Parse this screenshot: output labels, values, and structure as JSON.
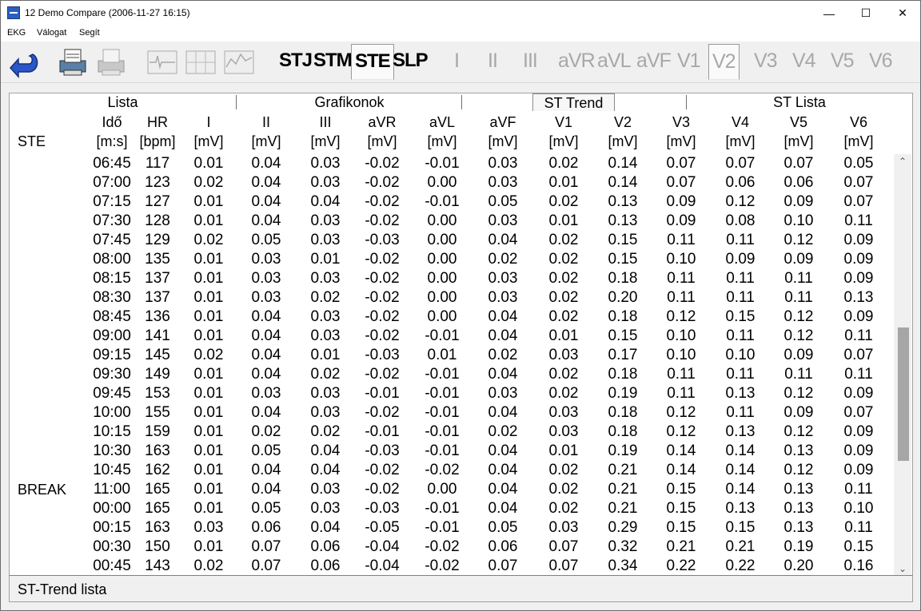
{
  "window": {
    "title": "12 Demo Compare (2006-11-27 16:15)"
  },
  "menu": [
    "EKG",
    "Válogat",
    "Segít"
  ],
  "toolbar": {
    "modes": [
      "STJ",
      "STM",
      "STE",
      "SLP"
    ],
    "active_mode": "STE",
    "leads": [
      "I",
      "II",
      "III",
      "aVR",
      "aVL",
      "aVF",
      "V1",
      "V2",
      "V3",
      "V4",
      "V5",
      "V6"
    ],
    "active_lead": "V2"
  },
  "tabs": [
    "Lista",
    "Grafikonok",
    "ST Trend",
    "ST Lista"
  ],
  "active_tab": "ST Trend",
  "table": {
    "mode_label": "STE",
    "columns": [
      {
        "name": "Idő",
        "unit": "[m:s]"
      },
      {
        "name": "HR",
        "unit": "[bpm]"
      },
      {
        "name": "I",
        "unit": "[mV]"
      },
      {
        "name": "II",
        "unit": "[mV]"
      },
      {
        "name": "III",
        "unit": "[mV]"
      },
      {
        "name": "aVR",
        "unit": "[mV]"
      },
      {
        "name": "aVL",
        "unit": "[mV]"
      },
      {
        "name": "aVF",
        "unit": "[mV]"
      },
      {
        "name": "V1",
        "unit": "[mV]"
      },
      {
        "name": "V2",
        "unit": "[mV]"
      },
      {
        "name": "V3",
        "unit": "[mV]"
      },
      {
        "name": "V4",
        "unit": "[mV]"
      },
      {
        "name": "V5",
        "unit": "[mV]"
      },
      {
        "name": "V6",
        "unit": "[mV]"
      }
    ],
    "rows": [
      {
        "label": "",
        "values": [
          "06:45",
          "117",
          "0.01",
          "0.04",
          "0.03",
          "-0.02",
          "-0.01",
          "0.03",
          "0.02",
          "0.14",
          "0.07",
          "0.07",
          "0.07",
          "0.05"
        ]
      },
      {
        "label": "",
        "values": [
          "07:00",
          "123",
          "0.02",
          "0.04",
          "0.03",
          "-0.02",
          "0.00",
          "0.03",
          "0.01",
          "0.14",
          "0.07",
          "0.06",
          "0.06",
          "0.07"
        ]
      },
      {
        "label": "",
        "values": [
          "07:15",
          "127",
          "0.01",
          "0.04",
          "0.04",
          "-0.02",
          "-0.01",
          "0.05",
          "0.02",
          "0.13",
          "0.09",
          "0.12",
          "0.09",
          "0.07"
        ]
      },
      {
        "label": "",
        "values": [
          "07:30",
          "128",
          "0.01",
          "0.04",
          "0.03",
          "-0.02",
          "0.00",
          "0.03",
          "0.01",
          "0.13",
          "0.09",
          "0.08",
          "0.10",
          "0.11"
        ]
      },
      {
        "label": "",
        "values": [
          "07:45",
          "129",
          "0.02",
          "0.05",
          "0.03",
          "-0.03",
          "0.00",
          "0.04",
          "0.02",
          "0.15",
          "0.11",
          "0.11",
          "0.12",
          "0.09"
        ]
      },
      {
        "label": "",
        "values": [
          "08:00",
          "135",
          "0.01",
          "0.03",
          "0.01",
          "-0.02",
          "0.00",
          "0.02",
          "0.02",
          "0.15",
          "0.10",
          "0.09",
          "0.09",
          "0.09"
        ]
      },
      {
        "label": "",
        "values": [
          "08:15",
          "137",
          "0.01",
          "0.03",
          "0.03",
          "-0.02",
          "0.00",
          "0.03",
          "0.02",
          "0.18",
          "0.11",
          "0.11",
          "0.11",
          "0.09"
        ]
      },
      {
        "label": "",
        "values": [
          "08:30",
          "137",
          "0.01",
          "0.03",
          "0.02",
          "-0.02",
          "0.00",
          "0.03",
          "0.02",
          "0.20",
          "0.11",
          "0.11",
          "0.11",
          "0.13"
        ]
      },
      {
        "label": "",
        "values": [
          "08:45",
          "136",
          "0.01",
          "0.04",
          "0.03",
          "-0.02",
          "0.00",
          "0.04",
          "0.02",
          "0.18",
          "0.12",
          "0.15",
          "0.12",
          "0.09"
        ]
      },
      {
        "label": "",
        "values": [
          "09:00",
          "141",
          "0.01",
          "0.04",
          "0.03",
          "-0.02",
          "-0.01",
          "0.04",
          "0.01",
          "0.15",
          "0.10",
          "0.11",
          "0.12",
          "0.11"
        ]
      },
      {
        "label": "",
        "values": [
          "09:15",
          "145",
          "0.02",
          "0.04",
          "0.01",
          "-0.03",
          "0.01",
          "0.02",
          "0.03",
          "0.17",
          "0.10",
          "0.10",
          "0.09",
          "0.07"
        ]
      },
      {
        "label": "",
        "values": [
          "09:30",
          "149",
          "0.01",
          "0.04",
          "0.02",
          "-0.02",
          "-0.01",
          "0.04",
          "0.02",
          "0.18",
          "0.11",
          "0.11",
          "0.11",
          "0.11"
        ]
      },
      {
        "label": "",
        "values": [
          "09:45",
          "153",
          "0.01",
          "0.03",
          "0.03",
          "-0.01",
          "-0.01",
          "0.03",
          "0.02",
          "0.19",
          "0.11",
          "0.13",
          "0.12",
          "0.09"
        ]
      },
      {
        "label": "",
        "values": [
          "10:00",
          "155",
          "0.01",
          "0.04",
          "0.03",
          "-0.02",
          "-0.01",
          "0.04",
          "0.03",
          "0.18",
          "0.12",
          "0.11",
          "0.09",
          "0.07"
        ]
      },
      {
        "label": "",
        "values": [
          "10:15",
          "159",
          "0.01",
          "0.02",
          "0.02",
          "-0.01",
          "-0.01",
          "0.02",
          "0.03",
          "0.18",
          "0.12",
          "0.13",
          "0.12",
          "0.09"
        ]
      },
      {
        "label": "",
        "values": [
          "10:30",
          "163",
          "0.01",
          "0.05",
          "0.04",
          "-0.03",
          "-0.01",
          "0.04",
          "0.01",
          "0.19",
          "0.14",
          "0.14",
          "0.13",
          "0.09"
        ]
      },
      {
        "label": "",
        "values": [
          "10:45",
          "162",
          "0.01",
          "0.04",
          "0.04",
          "-0.02",
          "-0.02",
          "0.04",
          "0.02",
          "0.21",
          "0.14",
          "0.14",
          "0.12",
          "0.09"
        ]
      },
      {
        "label": "BREAK",
        "values": [
          "11:00",
          "165",
          "0.01",
          "0.04",
          "0.03",
          "-0.02",
          "0.00",
          "0.04",
          "0.02",
          "0.21",
          "0.15",
          "0.14",
          "0.13",
          "0.11"
        ]
      },
      {
        "label": "",
        "values": [
          "00:00",
          "165",
          "0.01",
          "0.05",
          "0.03",
          "-0.03",
          "-0.01",
          "0.04",
          "0.02",
          "0.21",
          "0.15",
          "0.13",
          "0.13",
          "0.10"
        ]
      },
      {
        "label": "",
        "values": [
          "00:15",
          "163",
          "0.03",
          "0.06",
          "0.04",
          "-0.05",
          "-0.01",
          "0.05",
          "0.03",
          "0.29",
          "0.15",
          "0.15",
          "0.13",
          "0.11"
        ]
      },
      {
        "label": "",
        "values": [
          "00:30",
          "150",
          "0.01",
          "0.07",
          "0.06",
          "-0.04",
          "-0.02",
          "0.06",
          "0.07",
          "0.32",
          "0.21",
          "0.21",
          "0.19",
          "0.15"
        ]
      },
      {
        "label": "",
        "values": [
          "00:45",
          "143",
          "0.02",
          "0.07",
          "0.06",
          "-0.04",
          "-0.02",
          "0.07",
          "0.07",
          "0.34",
          "0.22",
          "0.22",
          "0.20",
          "0.16"
        ]
      }
    ]
  },
  "status": {
    "text": "ST-Trend lista"
  }
}
